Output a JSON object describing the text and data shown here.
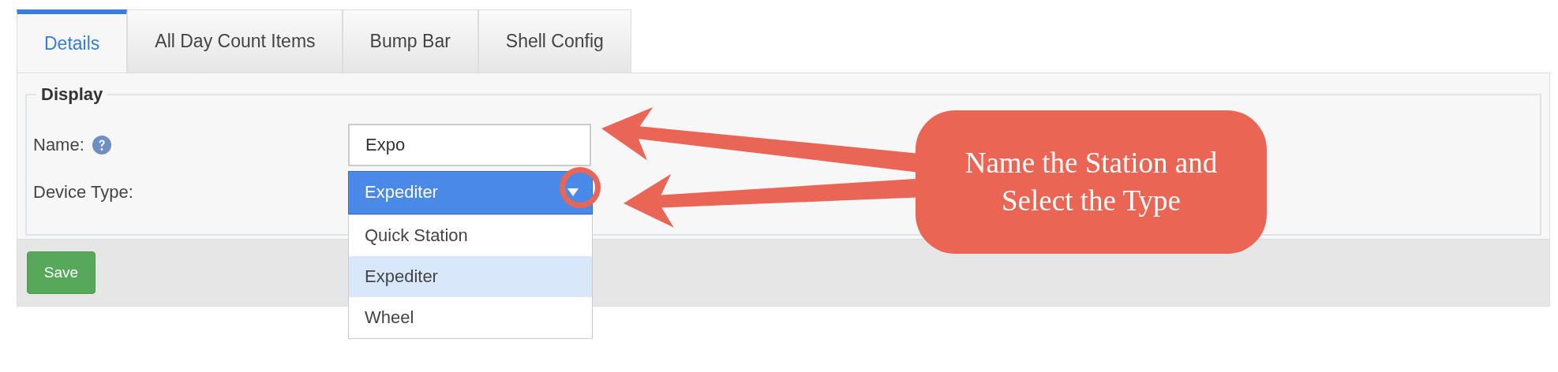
{
  "tabs": [
    {
      "label": "Details",
      "selected": true
    },
    {
      "label": "All Day Count Items",
      "selected": false
    },
    {
      "label": "Bump Bar",
      "selected": false
    },
    {
      "label": "Shell Config",
      "selected": false
    }
  ],
  "section": {
    "legend": "Display"
  },
  "fields": [
    {
      "kind": "text",
      "label": "Name:",
      "help": true,
      "value": "Expo"
    },
    {
      "kind": "select",
      "label": "Device Type:",
      "help": false,
      "value": "Expediter",
      "open": true,
      "highlighted": true,
      "options": [
        {
          "label": "Quick Station",
          "selected": false
        },
        {
          "label": "Expediter",
          "selected": true
        },
        {
          "label": "Wheel",
          "selected": false
        }
      ]
    }
  ],
  "save_button": "Save",
  "callout": {
    "text": "Name the Station and Select the Type"
  }
}
